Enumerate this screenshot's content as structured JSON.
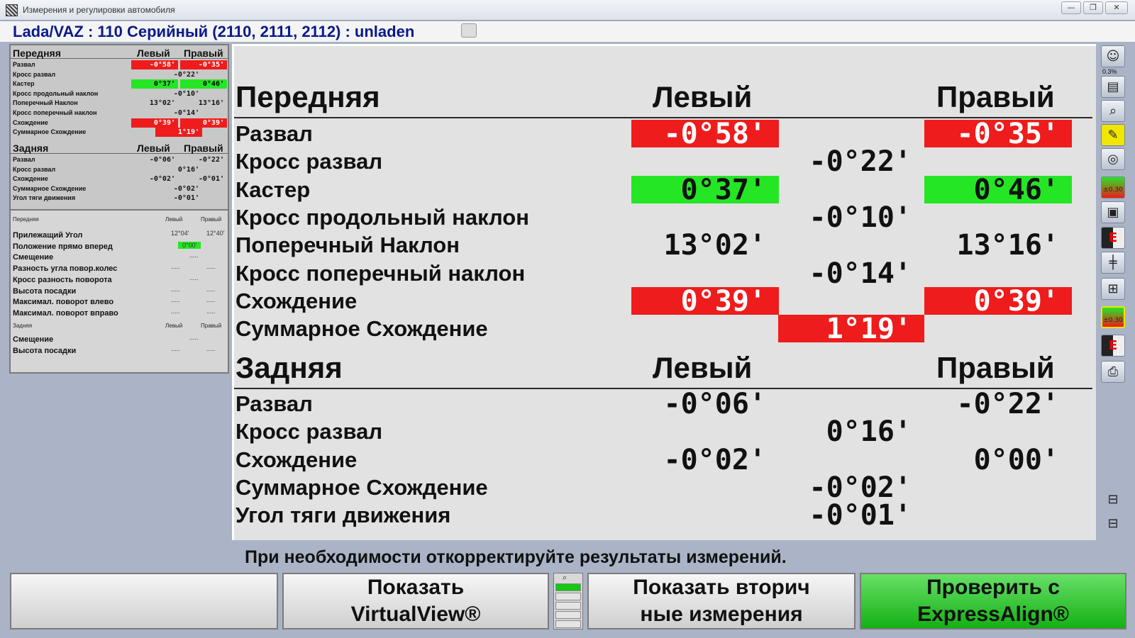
{
  "window": {
    "title": "Измерения и регулировки автомобиля",
    "buttons": [
      "—",
      "❐",
      "✕"
    ]
  },
  "vehicle": {
    "title": "Lada/VAZ : 110 Серийный (2110, 2111, 2112) : unladen"
  },
  "summary": {
    "front": {
      "header": "Передняя",
      "left": "Левый",
      "right": "Правый",
      "rows": [
        {
          "label": "Развал",
          "left": "-0°58'",
          "right": "-0°35'"
        },
        {
          "label": "Кросс развал",
          "center": "-0°22'"
        },
        {
          "label": "Кастер",
          "left": "0°37'",
          "right": "0°46'"
        },
        {
          "label": "Кросс продольный наклон",
          "center": "-0°10'"
        },
        {
          "label": "Поперечный Наклон",
          "left": "13°02'",
          "right": "13°16'"
        },
        {
          "label": "Кросс поперечный наклон",
          "center": "-0°14'"
        },
        {
          "label": "Схождение",
          "left": "0°39'",
          "right": "0°39'"
        },
        {
          "label": "Суммарное Схождение",
          "center": "1°19'"
        }
      ]
    },
    "rear": {
      "header": "Задняя",
      "left": "Левый",
      "right": "Правый",
      "rows": [
        {
          "label": "Развал",
          "left": "-0°06'",
          "right": "-0°22'"
        },
        {
          "label": "Кросс развал",
          "center": "0°16'"
        },
        {
          "label": "Схождение",
          "left": "-0°02'",
          "right": "-0°01'"
        },
        {
          "label": "Суммарное Схождение",
          "center": "-0°02'"
        },
        {
          "label": "Угол тяги движения",
          "center": "-0°01'"
        }
      ]
    }
  },
  "secondary": {
    "front": {
      "header": "Передняя",
      "left": "Левый",
      "right": "Правый",
      "rows": [
        {
          "label": "Прилежащий Угол",
          "left": "12°04'",
          "right": "12°40'"
        },
        {
          "label": "Положение прямо вперед",
          "center": "0°00'"
        },
        {
          "label": "Смещение",
          "center": "....."
        },
        {
          "label": "Разность угла повор.колес",
          "left": ".....",
          "right": "....."
        },
        {
          "label": "Кросс разность поворота",
          "center": "....."
        },
        {
          "label": "Высота посадки",
          "left": ".....",
          "right": "....."
        },
        {
          "label": "Максимал. поворот влево",
          "left": ".....",
          "right": "....."
        },
        {
          "label": "Максимал. поворот вправо",
          "left": ".....",
          "right": "....."
        }
      ]
    },
    "rear": {
      "header": "Задняя",
      "left": "Левый",
      "right": "Правый",
      "rows": [
        {
          "label": "Смещение",
          "center": "....."
        },
        {
          "label": "Высота посадки",
          "left": ".....",
          "right": "....."
        }
      ]
    }
  },
  "main": {
    "front": {
      "header": "Передняя",
      "left": "Левый",
      "right": "Правый",
      "rows": [
        {
          "label": "Развал",
          "left": "-0°58'",
          "right": "-0°35'",
          "left_status": "red",
          "right_status": "red"
        },
        {
          "label": "Кросс развал",
          "center": "-0°22'"
        },
        {
          "label": "Кастер",
          "left": "0°37'",
          "right": "0°46'",
          "left_status": "green",
          "right_status": "green"
        },
        {
          "label": "Кросс продольный наклон",
          "center": "-0°10'"
        },
        {
          "label": "Поперечный Наклон",
          "left": "13°02'",
          "right": "13°16'"
        },
        {
          "label": "Кросс поперечный наклон",
          "center": "-0°14'"
        },
        {
          "label": "Схождение",
          "left": "0°39'",
          "right": "0°39'",
          "left_status": "red",
          "right_status": "red"
        },
        {
          "label": "Суммарное Схождение",
          "center": "1°19'",
          "center_status": "red"
        }
      ]
    },
    "rear": {
      "header": "Задняя",
      "left": "Левый",
      "right": "Правый",
      "rows": [
        {
          "label": "Развал",
          "left": "-0°06'",
          "right": "-0°22'"
        },
        {
          "label": "Кросс развал",
          "center": "0°16'"
        },
        {
          "label": "Схождение",
          "left": "-0°02'",
          "right": "0°00'"
        },
        {
          "label": "Суммарное Схождение",
          "center": "-0°02'"
        },
        {
          "label": "Угол тяги движения",
          "center": "-0°01'"
        }
      ]
    }
  },
  "toolbar": {
    "zoom_label": "0.3%",
    "tools": [
      "person-icon",
      "book-icon",
      "magnifier-icon",
      "wrench-icon",
      "steering-icon",
      "specs-icon",
      "sensor-icon",
      "flag-icon",
      "axle-icon",
      "gauge-icon",
      "specs-active-icon",
      "flag-icon-2",
      "printer-icon",
      "car-top-icon",
      "car-top-icon-2"
    ]
  },
  "instruction": "При необходимости откорректируйте результаты измерений.",
  "buttons": {
    "b1": "",
    "b2_line1": "Показать",
    "b2_line2": "VirtualView®",
    "b3_line1": "Показать вторич",
    "b3_line2": "ные измерения",
    "b4_line1": "Проверить с",
    "b4_line2": "ExpressAlign®"
  },
  "colors": {
    "red": "#ee1c1c",
    "green": "#25e625",
    "title_blue": "#0a1a8a",
    "go_button": "#15b015"
  }
}
